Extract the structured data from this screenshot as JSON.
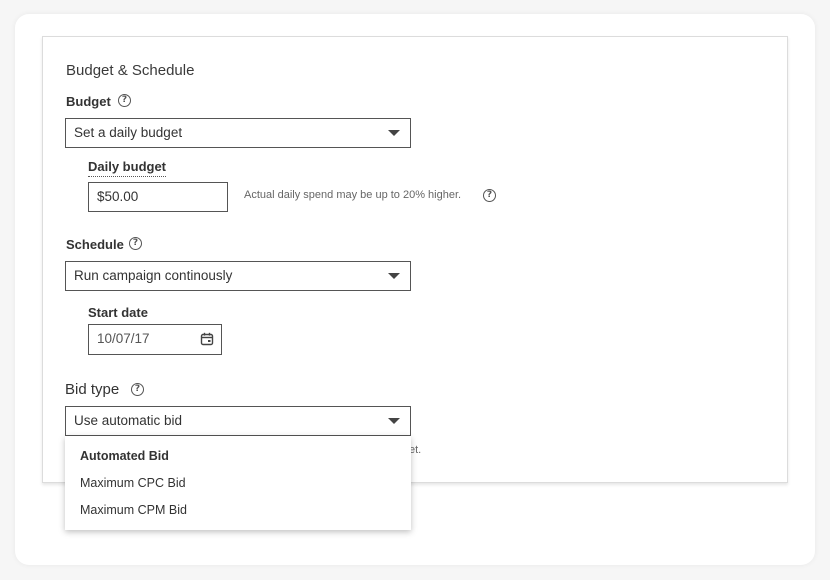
{
  "section_title": "Budget & Schedule",
  "budget": {
    "label": "Budget",
    "select_value": "Set a daily budget",
    "daily_budget_label": "Daily budget",
    "daily_budget_value": "$50.00",
    "hint": "Actual daily spend may be up to 20% higher."
  },
  "schedule": {
    "label": "Schedule",
    "select_value": "Run campaign continously",
    "start_date_label": "Start date",
    "start_date_value": "10/07/17"
  },
  "bid": {
    "label": "Bid type",
    "select_value": "Use automatic bid",
    "hidden_hint_tail": "et.",
    "options": [
      {
        "label": "Automated Bid",
        "selected": true
      },
      {
        "label": "Maximum CPC Bid",
        "selected": false
      },
      {
        "label": "Maximum CPM Bid",
        "selected": false
      }
    ]
  },
  "icons": {
    "help": "question-circle-icon",
    "caret": "caret-down-icon",
    "calendar": "calendar-icon"
  },
  "colors": {
    "border": "#555555",
    "text": "#333333",
    "background": "#f6f6f6"
  }
}
